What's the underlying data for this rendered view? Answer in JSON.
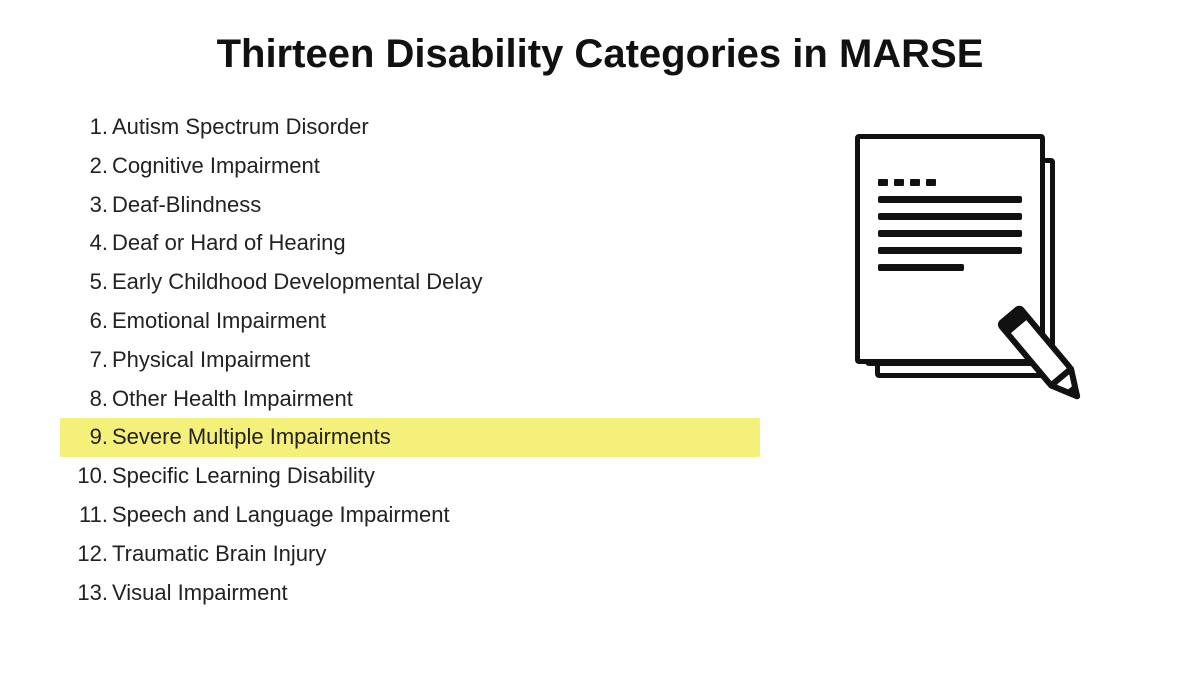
{
  "page": {
    "title": "Thirteen Disability Categories in MARSE",
    "list": {
      "items": [
        {
          "number": "1.",
          "text": "Autism Spectrum Disorder",
          "highlighted": false
        },
        {
          "number": "2.",
          "text": "Cognitive Impairment",
          "highlighted": false
        },
        {
          "number": "3.",
          "text": "Deaf-Blindness",
          "highlighted": false
        },
        {
          "number": "4.",
          "text": "Deaf or Hard of Hearing",
          "highlighted": false
        },
        {
          "number": "5.",
          "text": "Early Childhood Developmental Delay",
          "highlighted": false
        },
        {
          "number": "6.",
          "text": "Emotional Impairment",
          "highlighted": false
        },
        {
          "number": "7.",
          "text": "Physical Impairment",
          "highlighted": false
        },
        {
          "number": "8.",
          "text": "Other Health Impairment",
          "highlighted": false
        },
        {
          "number": "9.",
          "text": "Severe Multiple Impairments",
          "highlighted": true
        },
        {
          "number": "10.",
          "text": "Specific Learning Disability",
          "highlighted": false
        },
        {
          "number": "11.",
          "text": "Speech and Language Impairment",
          "highlighted": false
        },
        {
          "number": "12.",
          "text": "Traumatic Brain Injury",
          "highlighted": false
        },
        {
          "number": "13.",
          "text": "Visual Impairment",
          "highlighted": false
        }
      ]
    },
    "icon": {
      "alt": "Documents with pencil icon"
    }
  }
}
